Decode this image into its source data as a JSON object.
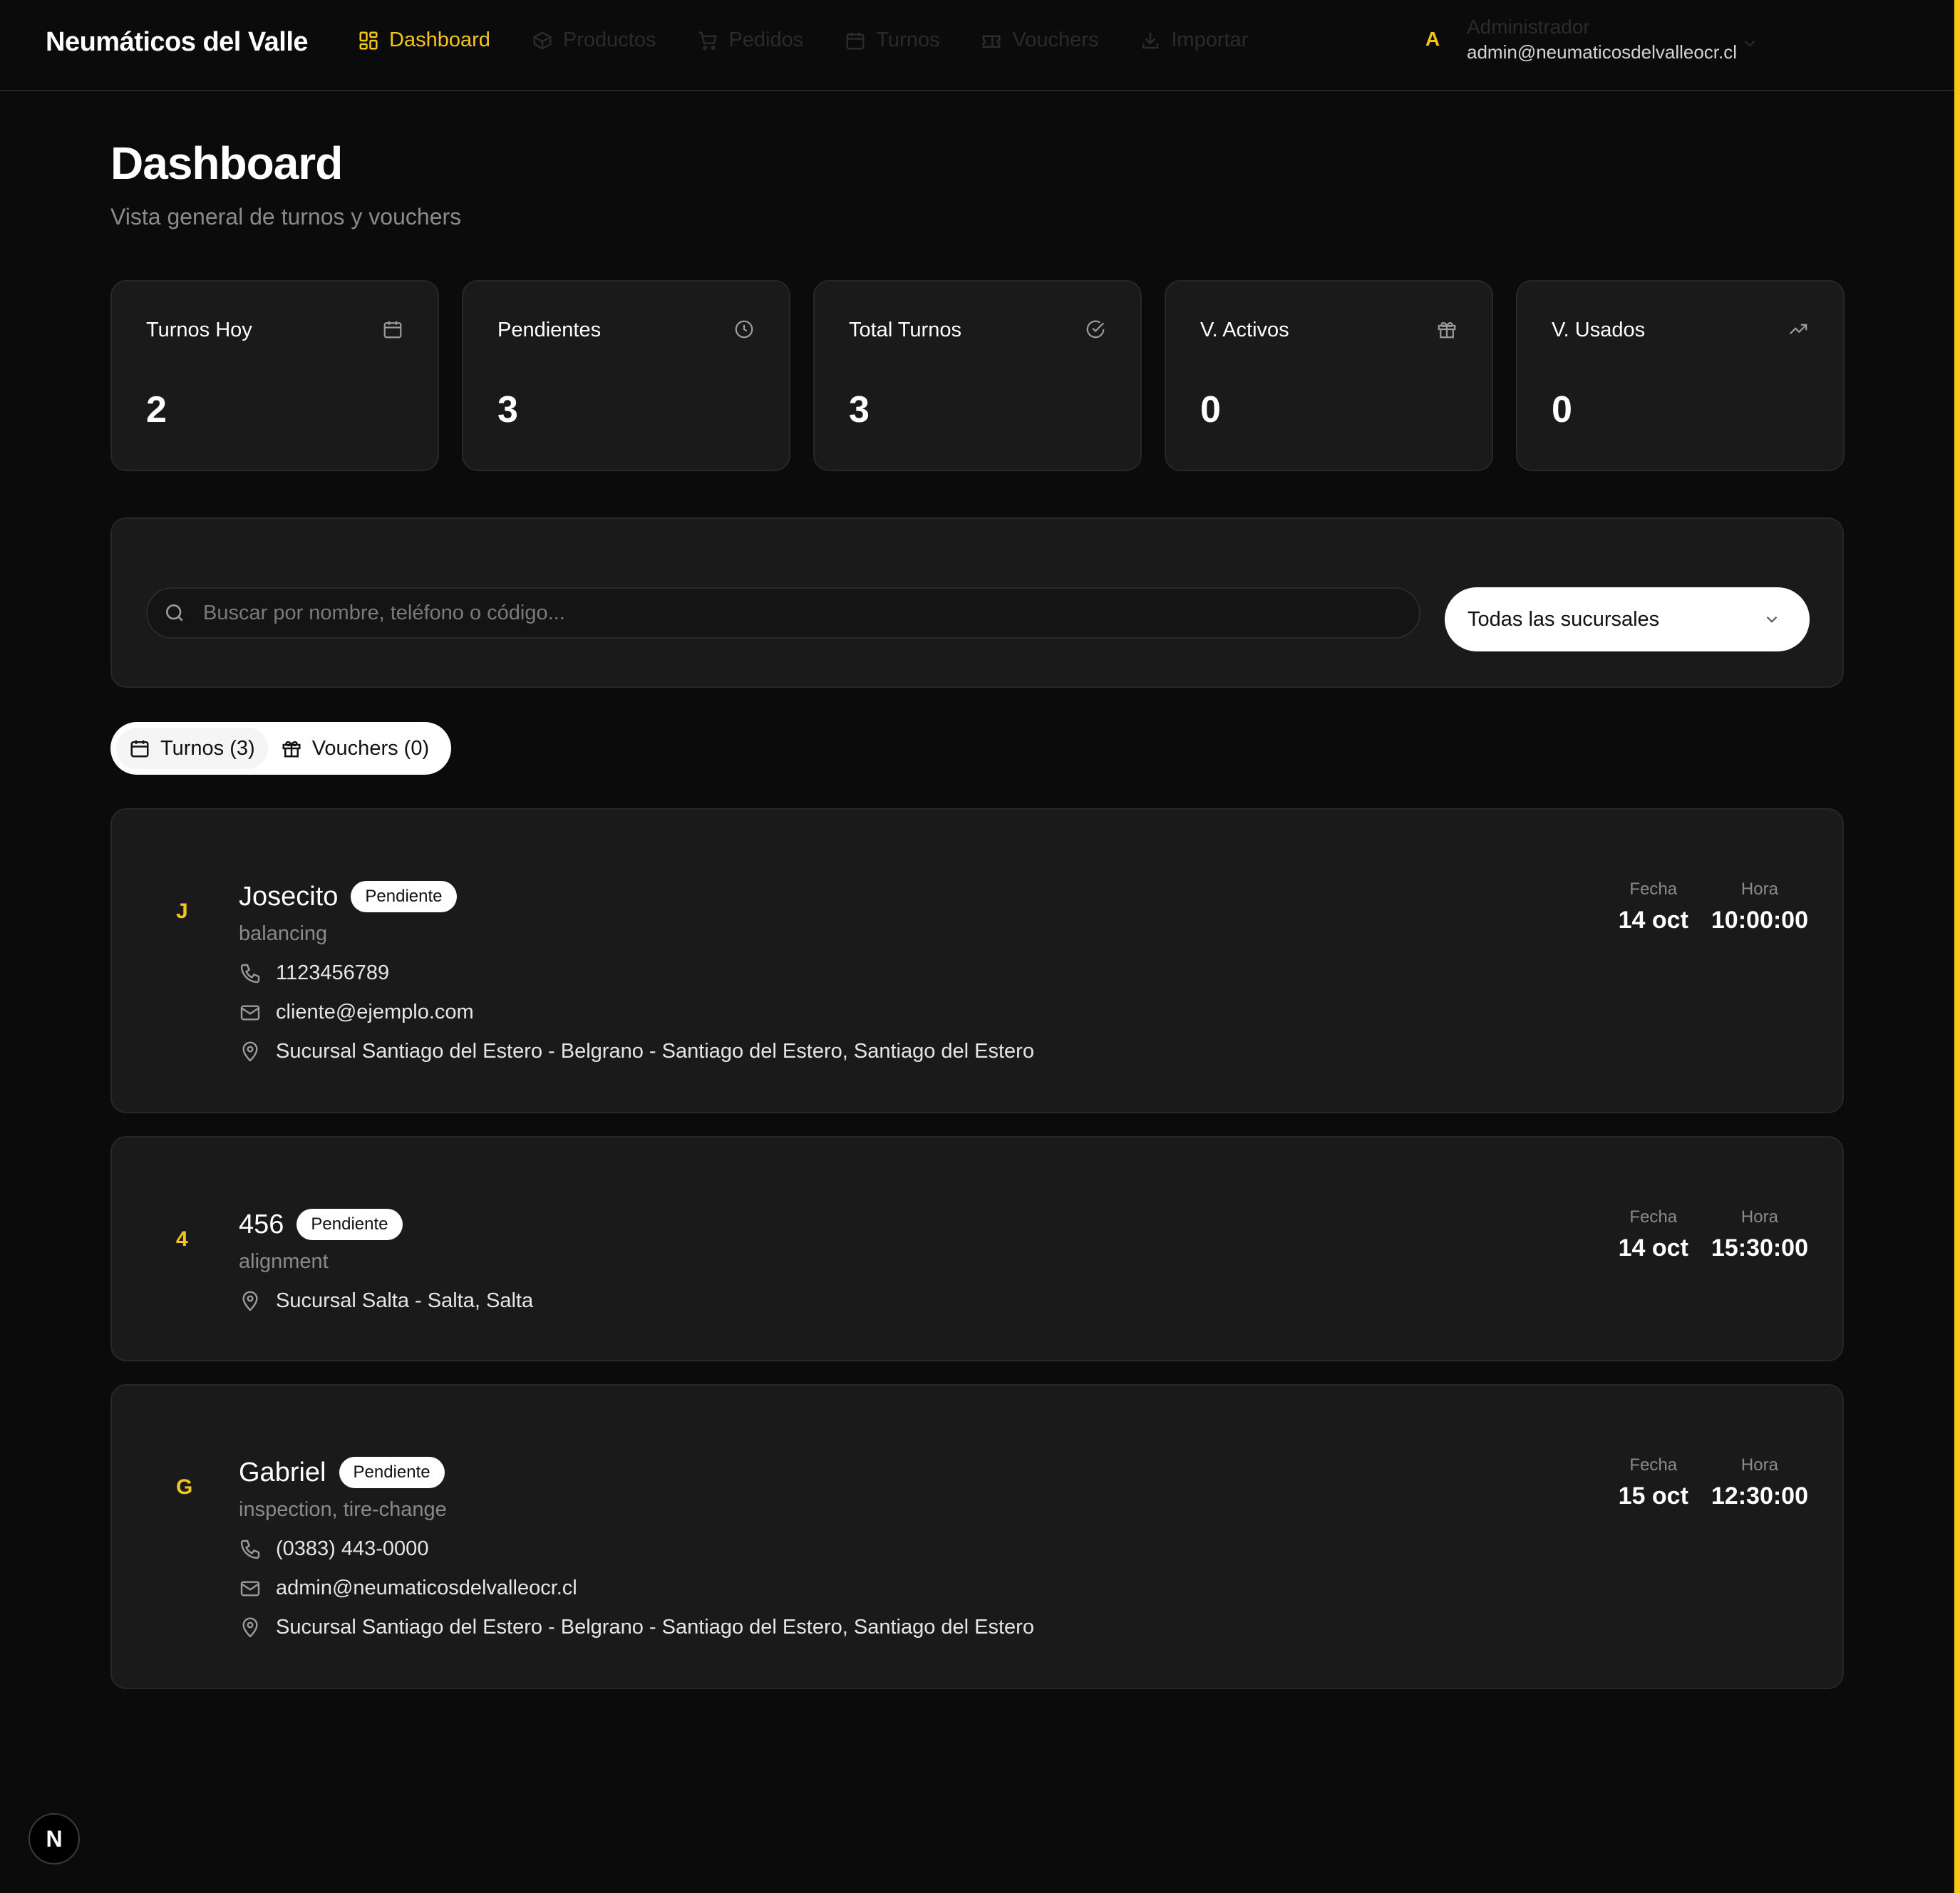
{
  "brand": "Neumáticos del Valle",
  "nav": [
    {
      "label": "Dashboard",
      "icon": "dashboard-icon",
      "active": true
    },
    {
      "label": "Productos",
      "icon": "box-icon",
      "active": false
    },
    {
      "label": "Pedidos",
      "icon": "cart-icon",
      "active": false
    },
    {
      "label": "Turnos",
      "icon": "calendar-icon",
      "active": false
    },
    {
      "label": "Vouchers",
      "icon": "ticket-icon",
      "active": false
    },
    {
      "label": "Importar",
      "icon": "import-icon",
      "active": false
    }
  ],
  "user": {
    "initial": "A",
    "name": "Administrador",
    "email": "admin@neumaticosdelvalleocr.cl"
  },
  "page": {
    "title": "Dashboard",
    "subtitle": "Vista general de turnos y vouchers"
  },
  "stats": [
    {
      "label": "Turnos Hoy",
      "value": "2",
      "icon": "calendar-icon"
    },
    {
      "label": "Pendientes",
      "value": "3",
      "icon": "clock-icon"
    },
    {
      "label": "Total Turnos",
      "value": "3",
      "icon": "check-circle-icon"
    },
    {
      "label": "V. Activos",
      "value": "0",
      "icon": "gift-icon"
    },
    {
      "label": "V. Usados",
      "value": "0",
      "icon": "trending-up-icon"
    }
  ],
  "filters": {
    "search_placeholder": "Buscar por nombre, teléfono o código...",
    "branch_selected": "Todas las sucursales"
  },
  "tabs": [
    {
      "label": "Turnos (3)",
      "icon": "calendar-icon",
      "active": true
    },
    {
      "label": "Vouchers (0)",
      "icon": "gift-icon",
      "active": false
    }
  ],
  "labels": {
    "fecha": "Fecha",
    "hora": "Hora"
  },
  "appointments": [
    {
      "initial": "J",
      "name": "Josecito",
      "status": "Pendiente",
      "service": "balancing",
      "phone": "1123456789",
      "email": "cliente@ejemplo.com",
      "location": "Sucursal Santiago del Estero - Belgrano - Santiago del Estero, Santiago del Estero",
      "date": "14 oct",
      "time": "10:00:00"
    },
    {
      "initial": "4",
      "name": "456",
      "status": "Pendiente",
      "service": "alignment",
      "phone": "",
      "email": "",
      "location": "Sucursal Salta - Salta, Salta",
      "date": "14 oct",
      "time": "15:30:00"
    },
    {
      "initial": "G",
      "name": "Gabriel",
      "status": "Pendiente",
      "service": "inspection, tire-change",
      "phone": "(0383) 443-0000",
      "email": "admin@neumaticosdelvalleocr.cl",
      "location": "Sucursal Santiago del Estero - Belgrano - Santiago del Estero, Santiago del Estero",
      "date": "15 oct",
      "time": "12:30:00"
    }
  ],
  "next_badge": "N",
  "colors": {
    "accent": "#f5c518",
    "background": "#0b0b0b",
    "card": "#1a1a1a"
  }
}
